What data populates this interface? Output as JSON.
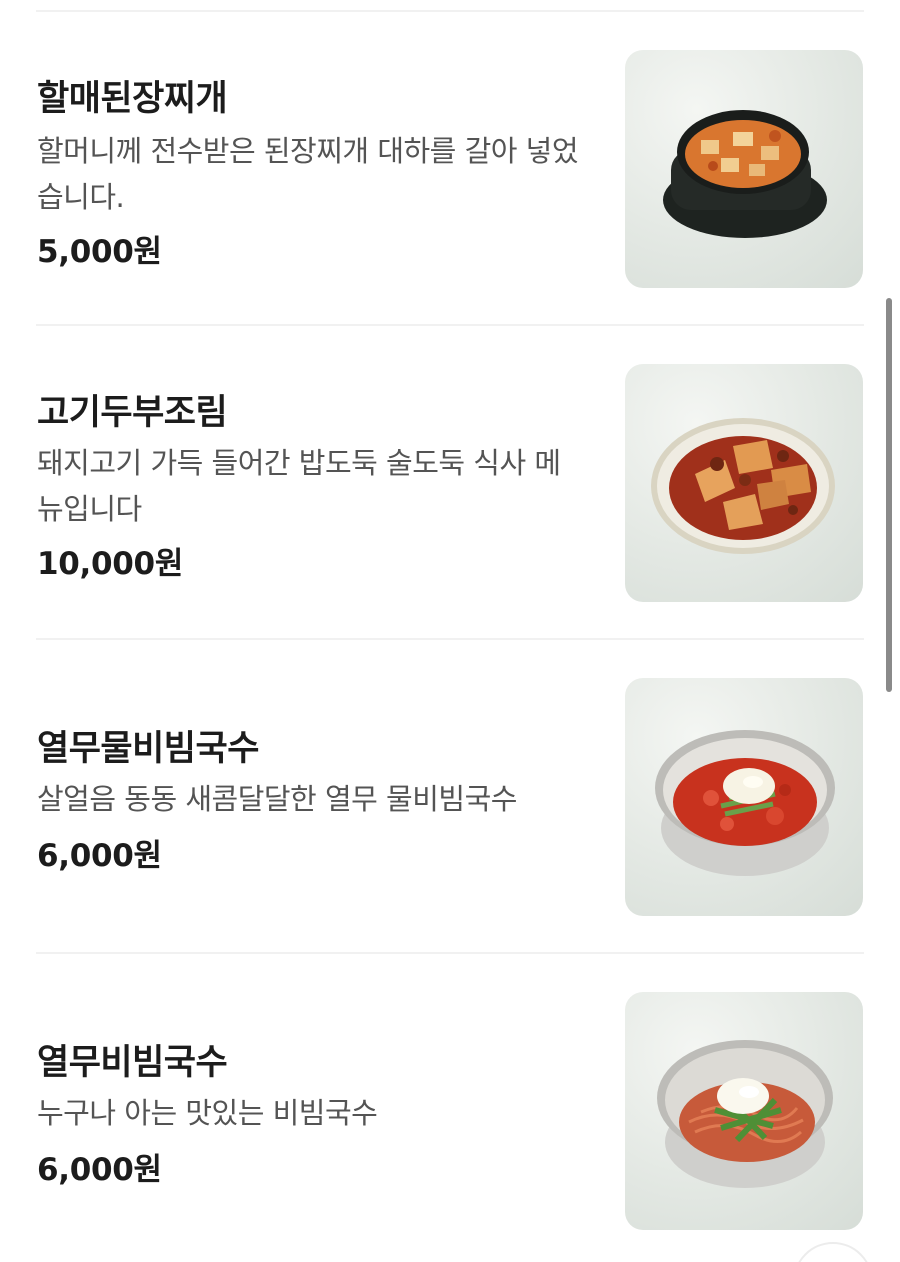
{
  "menu": {
    "items": [
      {
        "name": "할매된장찌개",
        "description": "할머니께 전수받은 된장찌개 대하를 갈아 넣었습니다.",
        "price": "5,000원",
        "image": "doenjang-stew-photo"
      },
      {
        "name": "고기두부조림",
        "description": "돼지고기 가득 들어간 밥도둑 술도둑 식사 메뉴입니다",
        "price": "10,000원",
        "image": "braised-tofu-photo"
      },
      {
        "name": "열무물비빔국수",
        "description": "살얼음 동동 새콤달달한 열무 물비빔국수",
        "price": "6,000원",
        "image": "cold-spicy-noodle-soup-photo"
      },
      {
        "name": "열무비빔국수",
        "description": "누구나 아는 맛있는 비빔국수",
        "price": "6,000원",
        "image": "bibim-noodle-photo"
      }
    ]
  },
  "colors": {
    "text_primary": "#1c1c1c",
    "text_secondary": "#545454",
    "divider": "#f1f1f1"
  }
}
